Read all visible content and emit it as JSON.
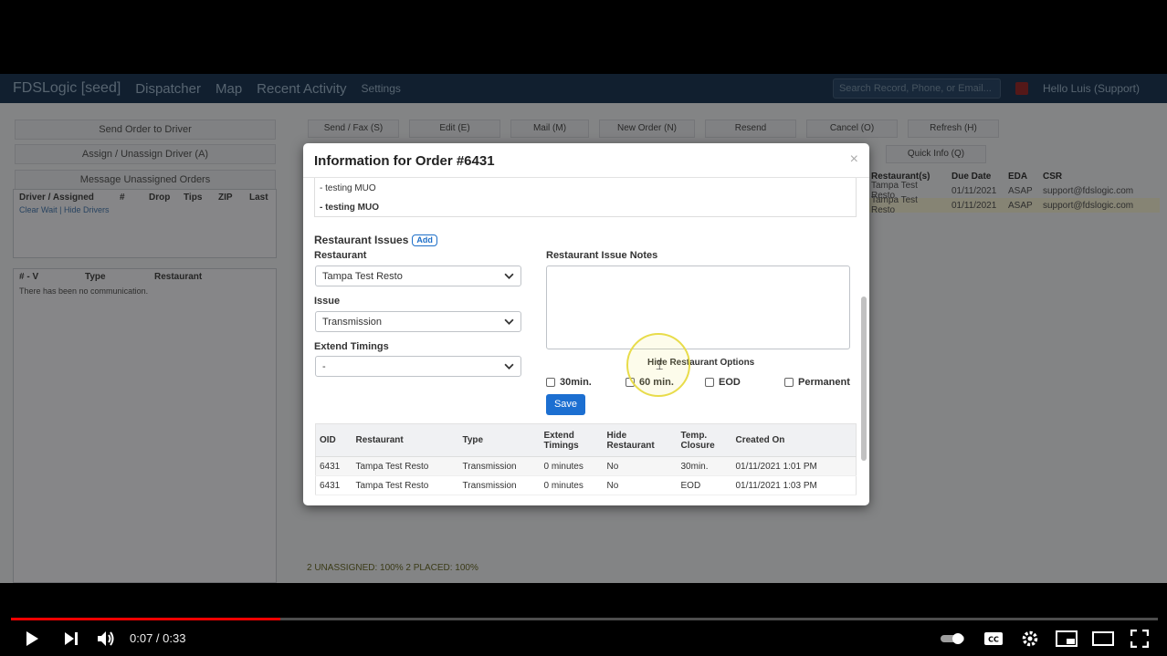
{
  "background_app": {
    "nav": {
      "brand": "FDSLogic [seed]",
      "items": [
        "Dispatcher",
        "Map",
        "Recent Activity",
        "Settings"
      ],
      "search_placeholder": "Search Record, Phone, or Email...",
      "user": "Hello Luis (Support)"
    },
    "left_buttons": [
      "Send Order to Driver",
      "Assign / Unassign Driver (A)",
      "Message Unassigned Orders"
    ],
    "driver_table": {
      "headers": [
        "Driver / Assigned",
        "#",
        "Drop",
        "Tips",
        "ZIP",
        "Last"
      ],
      "links": "Clear Wait | Hide Drivers"
    },
    "comm_table": {
      "headers": [
        "# - V",
        "Type",
        "Restaurant"
      ],
      "empty": "There has been no communication."
    },
    "toolbar": [
      "Send / Fax (S)",
      "Edit (E)",
      "Mail (M)",
      "New Order (N)",
      "Resend",
      "Cancel (O)",
      "Refresh (H)",
      "Quick Info (Q)"
    ],
    "orders_table": {
      "headers": [
        "Restaurant(s)",
        "Due Date",
        "EDA",
        "CSR"
      ],
      "rows": [
        [
          "Tampa Test Resto",
          "01/11/2021",
          "ASAP",
          "support@fdslogic.com"
        ],
        [
          "Tampa Test Resto",
          "01/11/2021",
          "ASAP",
          "support@fdslogic.com"
        ]
      ]
    },
    "status_line": "2 UNASSIGNED: 100%   2 PLACED: 100%"
  },
  "modal": {
    "title": "Information for Order #6431",
    "close": "×",
    "notes": [
      "- testing MUO",
      "- testing MUO"
    ],
    "section_title": "Restaurant Issues",
    "add_label": "Add",
    "restaurant_label": "Restaurant",
    "restaurant_value": "Tampa Test Resto",
    "issue_label": "Issue",
    "issue_value": "Transmission",
    "extend_label": "Extend Timings",
    "extend_value": "-",
    "issue_notes_label": "Restaurant Issue Notes",
    "hide_options_label": "Hide Restaurant Options",
    "options": [
      "30min.",
      "60 min.",
      "EOD",
      "Permanent"
    ],
    "save_label": "Save",
    "table": {
      "headers": [
        "OID",
        "Restaurant",
        "Type",
        "Extend Timings",
        "Hide Restaurant",
        "Temp. Closure",
        "Created On"
      ],
      "rows": [
        [
          "6431",
          "Tampa Test Resto",
          "Transmission",
          "0 minutes",
          "No",
          "30min.",
          "01/11/2021 1:01 PM"
        ],
        [
          "6431",
          "Tampa Test Resto",
          "Transmission",
          "0 minutes",
          "No",
          "EOD",
          "01/11/2021 1:03 PM"
        ]
      ]
    }
  },
  "player": {
    "time": "0:07 / 0:33",
    "progress": 0.235,
    "accent": "#ff0000"
  }
}
